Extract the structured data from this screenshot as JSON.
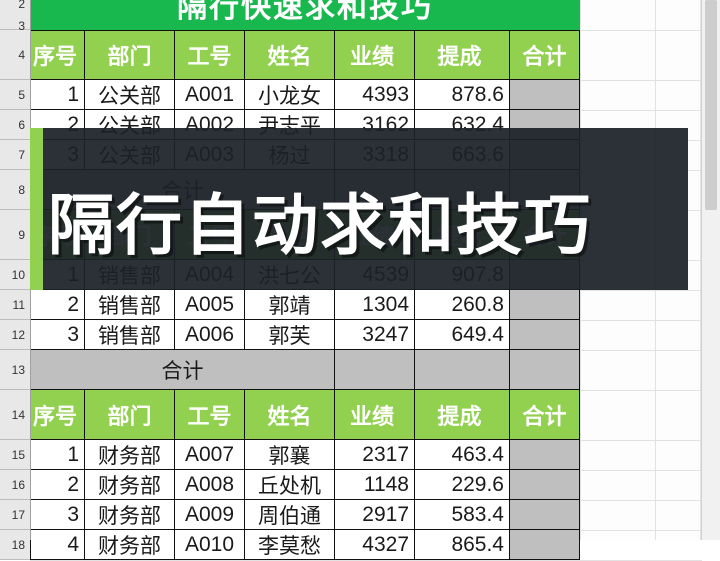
{
  "banner": {
    "title": "隔行快速求和技巧"
  },
  "overlay": {
    "caption": "隔行自动求和技巧"
  },
  "colors": {
    "banner_green": "#19b84f",
    "header_green": "#92d050",
    "total_gray": "#bfbfbf",
    "overlay_dark": "#1c2129"
  },
  "row_numbers": [
    "2",
    "3",
    "4",
    "5",
    "6",
    "7",
    "8",
    "9",
    "10",
    "11",
    "12",
    "13",
    "14",
    "15",
    "16",
    "17",
    "18"
  ],
  "columns": [
    "序号",
    "部门",
    "工号",
    "姓名",
    "业绩",
    "提成",
    "合计"
  ],
  "blocks": [
    {
      "header": [
        "序号",
        "部门",
        "工号",
        "姓名",
        "业绩",
        "提成",
        "合计"
      ],
      "rows": [
        [
          "1",
          "公关部",
          "A001",
          "小龙女",
          "4393",
          "878.6",
          ""
        ],
        [
          "2",
          "公关部",
          "A002",
          "尹志平",
          "3162",
          "632.4",
          ""
        ],
        [
          "3",
          "公关部",
          "A003",
          "杨过",
          "3318",
          "663.6",
          ""
        ]
      ],
      "total_label": "合计",
      "total_values": [
        "",
        "",
        ""
      ]
    },
    {
      "header": [
        "序号",
        "部门",
        "工号",
        "姓名",
        "业绩",
        "提成",
        "合计"
      ],
      "rows": [
        [
          "1",
          "销售部",
          "A004",
          "洪七公",
          "4539",
          "907.8",
          ""
        ],
        [
          "2",
          "销售部",
          "A005",
          "郭靖",
          "1304",
          "260.8",
          ""
        ],
        [
          "3",
          "销售部",
          "A006",
          "郭芙",
          "3247",
          "649.4",
          ""
        ]
      ],
      "total_label": "合计",
      "total_values": [
        "",
        "",
        ""
      ]
    },
    {
      "header": [
        "序号",
        "部门",
        "工号",
        "姓名",
        "业绩",
        "提成",
        "合计"
      ],
      "rows": [
        [
          "1",
          "财务部",
          "A007",
          "郭襄",
          "2317",
          "463.4",
          ""
        ],
        [
          "2",
          "财务部",
          "A008",
          "丘处机",
          "1148",
          "229.6",
          ""
        ],
        [
          "3",
          "财务部",
          "A009",
          "周伯通",
          "2917",
          "583.4",
          ""
        ],
        [
          "4",
          "财务部",
          "A010",
          "李莫愁",
          "4327",
          "865.4",
          ""
        ]
      ]
    }
  ]
}
